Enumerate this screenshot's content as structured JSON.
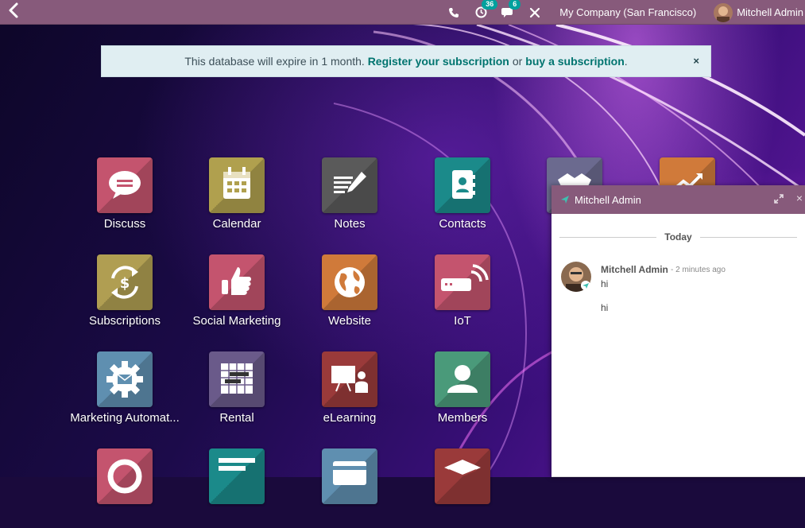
{
  "navbar": {
    "back_icon": "chevron-left-icon",
    "activity_badge": "36",
    "messages_badge": "6",
    "company": "My Company (San Francisco)",
    "user_name": "Mitchell Admin",
    "color": "#875a7b"
  },
  "banner": {
    "text": "This database will expire in 1 month.",
    "register_link": "Register your subscription",
    "or_text": "or",
    "buy_link": "buy a subscription",
    "period": ".",
    "close": "×"
  },
  "apps": [
    {
      "label": "Discuss",
      "color": "#c4546e",
      "icon": "chat-bubble-icon"
    },
    {
      "label": "Calendar",
      "color": "#b0a04e",
      "icon": "calendar-icon"
    },
    {
      "label": "Notes",
      "color": "#5a5a5a",
      "icon": "note-pencil-icon"
    },
    {
      "label": "Contacts",
      "color": "#1b8a8a",
      "icon": "address-book-icon"
    },
    {
      "label": "",
      "color": "#6b6a8f",
      "icon": "handshake-icon"
    },
    {
      "label": "",
      "color": "#d07a3a",
      "icon": "chart-up-icon"
    },
    {
      "label": "Subscriptions",
      "color": "#b09e52",
      "icon": "dollar-cycle-icon"
    },
    {
      "label": "Social Marketing",
      "color": "#c4546e",
      "icon": "thumbs-up-icon"
    },
    {
      "label": "Website",
      "color": "#d07a3a",
      "icon": "globe-icon"
    },
    {
      "label": "IoT",
      "color": "#c4546e",
      "icon": "wifi-device-icon"
    },
    {
      "label": "Marketing Automat...",
      "color": "#5f8fb0",
      "icon": "gear-mail-icon"
    },
    {
      "label": "Rental",
      "color": "#6a5a8a",
      "icon": "table-grid-icon"
    },
    {
      "label": "eLearning",
      "color": "#9a3a3a",
      "icon": "presentation-icon"
    },
    {
      "label": "Members",
      "color": "#4a9a7a",
      "icon": "user-icon"
    },
    {
      "label": "",
      "color": "#c4546e",
      "icon": "lifebuoy-icon"
    },
    {
      "label": "",
      "color": "#1b8a8a",
      "icon": "list-icon"
    },
    {
      "label": "",
      "color": "#5f8fb0",
      "icon": "card-icon"
    },
    {
      "label": "",
      "color": "#9a3a3a",
      "icon": "box-icon"
    }
  ],
  "chat": {
    "title": "Mitchell Admin",
    "day_label": "Today",
    "messages": [
      {
        "author": "Mitchell Admin",
        "time": "- 2 minutes ago",
        "text": "hi"
      },
      {
        "text": "hi"
      }
    ],
    "close": "×"
  }
}
